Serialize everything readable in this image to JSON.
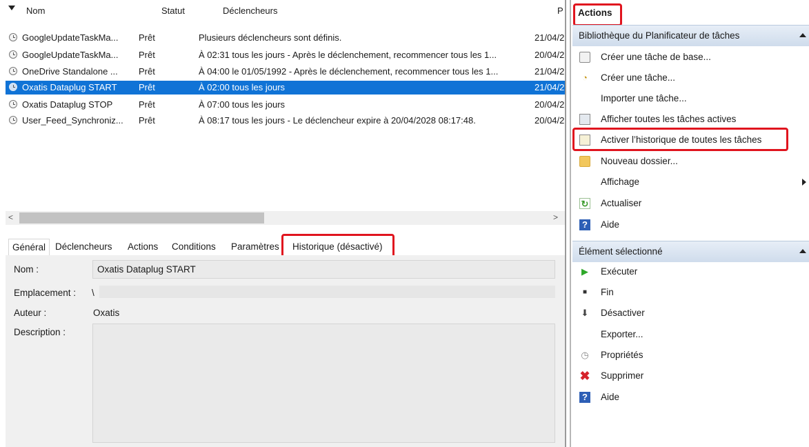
{
  "task_list": {
    "columns": [
      "Nom",
      "Statut",
      "Déclencheurs",
      "P"
    ],
    "rows": [
      {
        "name": "GoogleUpdateTaskMa...",
        "status": "Prêt",
        "trigger": "Plusieurs déclencheurs sont définis.",
        "next": "21/04/2"
      },
      {
        "name": "GoogleUpdateTaskMa...",
        "status": "Prêt",
        "trigger": "À 02:31 tous les jours - Après le déclenchement, recommencer tous les 1...",
        "next": "20/04/2"
      },
      {
        "name": "OneDrive Standalone ...",
        "status": "Prêt",
        "trigger": "À 04:00 le 01/05/1992 - Après le déclenchement, recommencer tous les 1...",
        "next": "21/04/2"
      },
      {
        "name": "Oxatis Dataplug START",
        "status": "Prêt",
        "trigger": "À 02:00 tous les jours",
        "next": "21/04/2"
      },
      {
        "name": "Oxatis Dataplug STOP",
        "status": "Prêt",
        "trigger": "À 07:00 tous les jours",
        "next": "20/04/2"
      },
      {
        "name": "User_Feed_Synchroniz...",
        "status": "Prêt",
        "trigger": "À 08:17 tous les jours - Le déclencheur expire à 20/04/2028 08:17:48.",
        "next": "20/04/2"
      }
    ],
    "scroll_left": "<",
    "scroll_right": ">"
  },
  "detail": {
    "tabs": [
      "Général",
      "Déclencheurs",
      "Actions",
      "Conditions",
      "Paramètres",
      "Historique (désactivé)"
    ],
    "name_label": "Nom :",
    "name_value": "Oxatis Dataplug START",
    "location_label": "Emplacement :",
    "location_value": "\\",
    "author_label": "Auteur :",
    "author_value": "Oxatis",
    "description_label": "Description :"
  },
  "actions": {
    "title": "Actions",
    "library_section": "Bibliothèque du Planificateur de tâches",
    "library_items": [
      "Créer une tâche de base...",
      "Créer une tâche...",
      "Importer une tâche...",
      "Afficher toutes les tâches actives",
      "Activer l’historique de toutes les tâches",
      "Nouveau dossier...",
      "Affichage",
      "Actualiser",
      "Aide"
    ],
    "selected_section": "Élément sélectionné",
    "selected_items": [
      "Exécuter",
      "Fin",
      "Désactiver",
      "Exporter...",
      "Propriétés",
      "Supprimer",
      "Aide"
    ]
  },
  "colors": {
    "selection": "#1073d6",
    "highlight_box": "#e0141e",
    "section_header": "#d6e2f0"
  }
}
